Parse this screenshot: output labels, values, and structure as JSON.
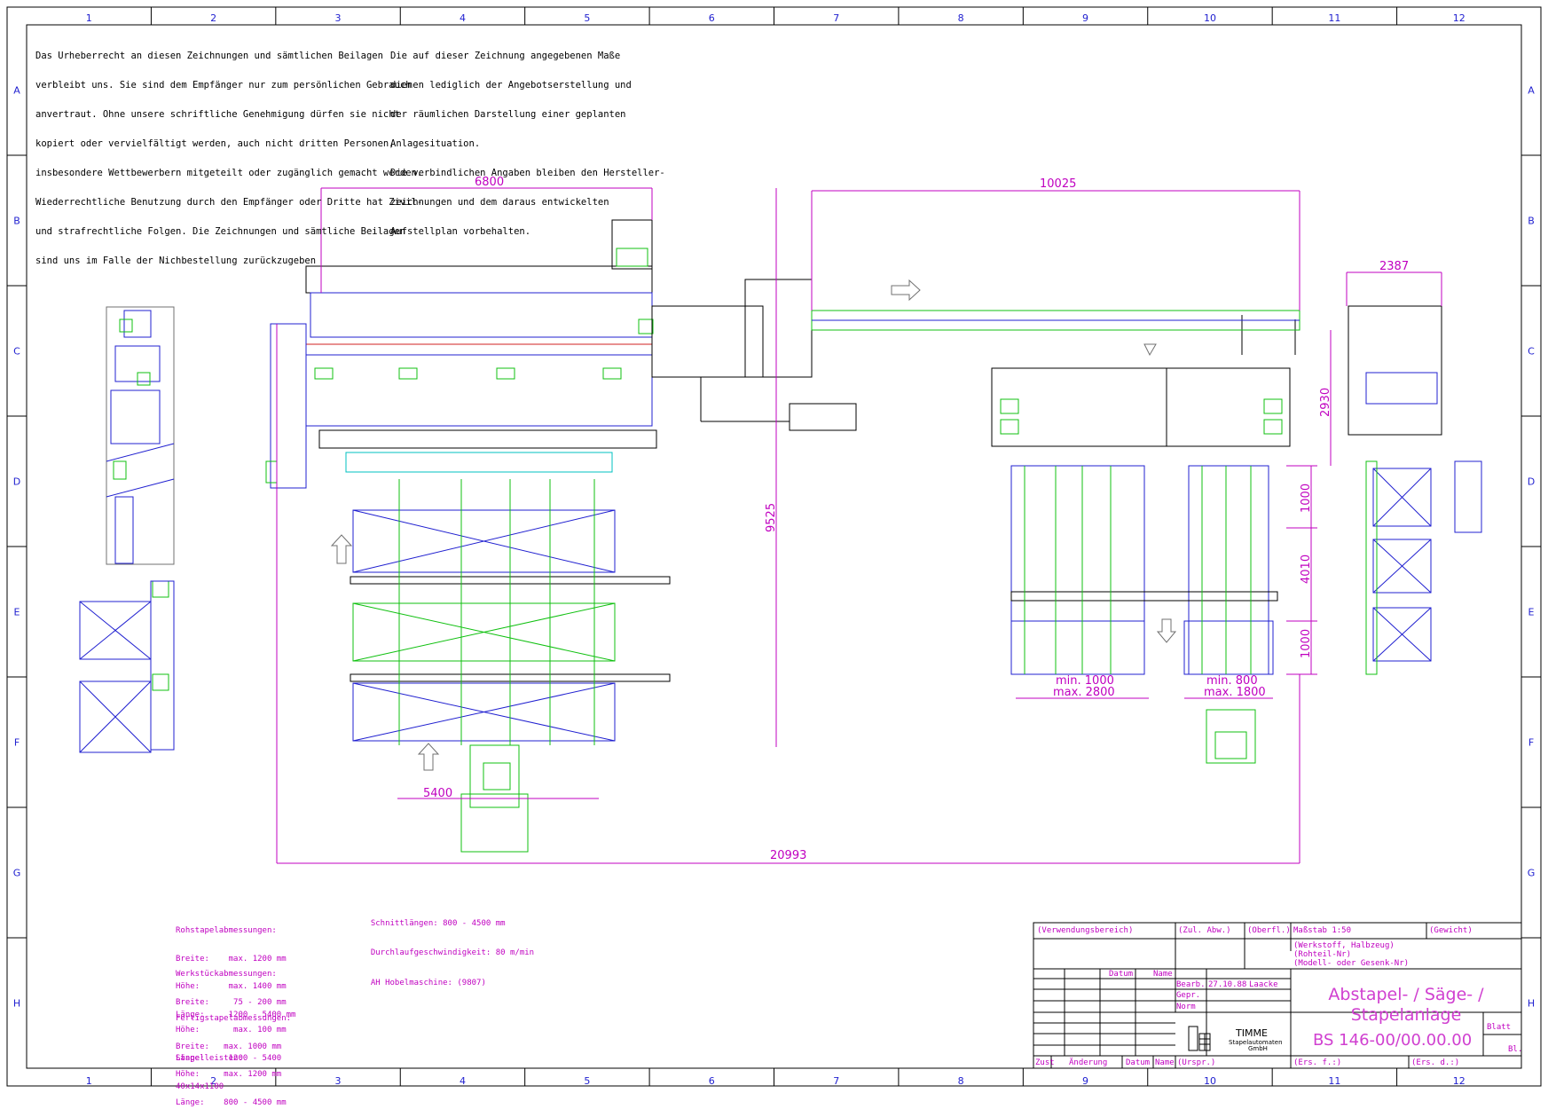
{
  "grid": {
    "columns": [
      "1",
      "2",
      "3",
      "4",
      "5",
      "6",
      "7",
      "8",
      "9",
      "10",
      "11",
      "12"
    ],
    "rows": [
      "A",
      "B",
      "C",
      "D",
      "E",
      "F",
      "G",
      "H"
    ]
  },
  "notes": {
    "copyright": [
      "Das Urheberrecht an diesen Zeichnungen und sämtlichen Beilagen",
      "verbleibt uns. Sie sind dem Empfänger nur zum persönlichen Gebrauch",
      "anvertraut. Ohne unsere schriftliche Genehmigung dürfen sie nicht",
      "kopiert oder vervielfältigt werden, auch nicht dritten Personen,",
      "insbesondere Wettbewerbern mitgeteilt oder zugänglich gemacht werden.",
      "Wiederrechtliche Benutzung durch den Empfänger oder Dritte hat Zivil-",
      "und strafrechtliche Folgen. Die Zeichnungen und sämtliche Beilagen",
      "sind uns im Falle der Nichbestellung zurückzugeben"
    ],
    "offer": [
      "Die auf dieser Zeichnung angegebenen Maße",
      "dienen lediglich der Angebotserstellung und",
      "der räumlichen Darstellung einer geplanten",
      "Anlagesituation.",
      "Die verbindlichen Angaben bleiben den Hersteller-",
      "zeichnungen und dem daraus entwickelten",
      "Aufstellplan vorbehalten."
    ]
  },
  "dimensions": {
    "d6800": "6800",
    "d10025": "10025",
    "d2387": "2387",
    "d2930": "2930",
    "d9525": "9525",
    "d1000a": "1000",
    "d4010": "4010",
    "d1000b": "1000",
    "d5400": "5400",
    "d20993": "20993",
    "min1000": "min. 1000",
    "max2800": "max. 2800",
    "min800": "min. 800",
    "max1800": "max. 1800"
  },
  "specs": {
    "rohstapel": [
      "Rohstapelabmessungen:",
      "Breite:    max. 1200 mm",
      "Höhe:      max. 1400 mm",
      "Länge:     1200 - 5400 mm"
    ],
    "werkstueck": [
      "Werkstückabmessungen:",
      "Breite:     75 - 200 mm",
      "Höhe:       max. 100 mm",
      "Länge:     1200 - 5400"
    ],
    "fertig": [
      "Fertigstapelabmessungen:",
      "Breite:   max. 1000 mm",
      "Höhe:     max. 1200 mm",
      "Länge:    800 - 4500 mm"
    ],
    "stapelleisten": [
      "Stapelleisten:",
      "40x14x1100"
    ],
    "schnitt": "Schnittlängen: 800 - 4500 mm",
    "durchlauf": "Durchlaufgeschwindigkeit: 80 m/min",
    "hobel": "AH Hobelmaschine: (9807)"
  },
  "title_block": {
    "verwendung": "(Verwendungsbereich)",
    "zul_abw": "(Zul. Abw.)",
    "oberfl": "(Oberfl.)",
    "massstab": "Maßstab  1:50",
    "gewicht": "(Gewicht)",
    "werkstoff": "(Werkstoff, Halbzeug)",
    "rohteil": "(Rohteil-Nr)",
    "modell": "(Modell- oder Gesenk-Nr)",
    "datum_hdr": "Datum",
    "name_hdr": "Name",
    "bearb": "Bearb.",
    "bearb_date": "27.10.88",
    "bearb_name": "Laacke",
    "gepr": "Gepr.",
    "norm": "Norm",
    "title_line1": "Abstapel- / Säge- /",
    "title_line2": "Stapelanlage",
    "company": "TIMME",
    "company_sub1": "Stapelautomaten",
    "company_sub2": "GmbH",
    "drawing_no": "BS 146-00/00.00.00",
    "blatt": "Blatt",
    "bl": "Bl.",
    "zust": "Zust",
    "aenderung": "Änderung",
    "datum": "Datum",
    "name": "Name",
    "urspr": "(Urspr.)",
    "ers_f": "(Ers. f.:)",
    "ers_d": "(Ers. d.:)"
  },
  "colors": {
    "frame": "#000000",
    "machine_blue": "#2020d0",
    "machine_green": "#10c010",
    "dimension": "#c000c0",
    "cyan": "#00c0c0",
    "red": "#d02020",
    "gray": "#707070"
  }
}
